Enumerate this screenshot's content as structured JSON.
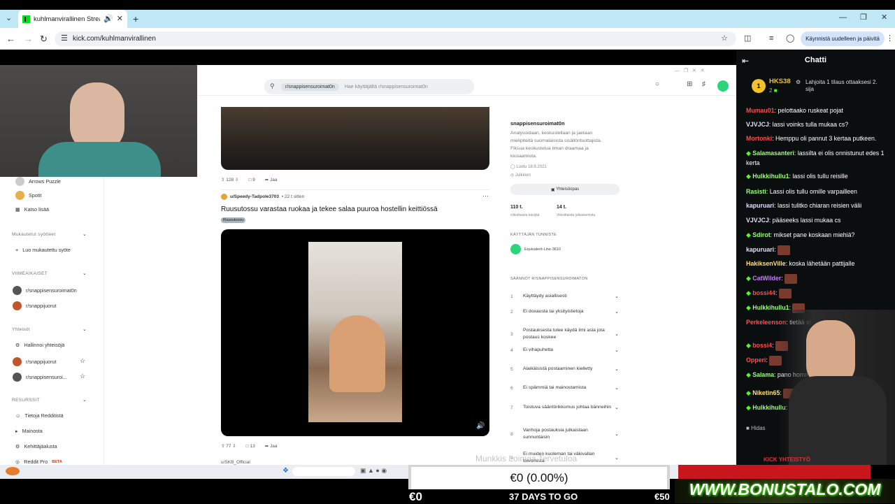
{
  "browser": {
    "tab_title": "kuhlmanvirallinen Stream -",
    "url": "kick.com/kuhlmanvirallinen",
    "update_button": "Käynnistä uudelleen ja päivitä"
  },
  "reddit": {
    "search_chip": "r/snappisensuroimat0n",
    "search_placeholder": "Hae käyttäjältä r/snappisensuroimat0n",
    "sidebar": {
      "items_top": [
        "Arrows Puzzle",
        "Spotit",
        "Katso lisää"
      ],
      "custom_heading": "Mukautetut syötteet",
      "custom_item": "Luo mukautettu syöte",
      "recent_heading": "VIIMEAIKAISET",
      "recent": [
        "r/snappisensuroimat0n",
        "r/snappijuorut"
      ],
      "communities_heading": "Yhteisöt",
      "communities": [
        "Hallinnoi yhteisöjä",
        "r/snappijuorut",
        "r/snappisensuroi..."
      ],
      "resources_heading": "RESURSSIT",
      "resources": [
        "Tietoja Redditistä",
        "Mainosta",
        "Kehittäjäalusta",
        "Reddit Pro"
      ],
      "beta": "BETA"
    },
    "post1": {
      "upvotes": "128",
      "comments": "9",
      "share": "Jaa"
    },
    "post2": {
      "author": "u/Speedy-Tadpole3703",
      "time": "• 22 t sitten",
      "title": "Ruusutossu varastaa ruokaa ja tekee salaa puuroa hostellin keittiössä",
      "flair": "Ruusutossu",
      "upvotes": "77",
      "comments": "13",
      "share": "Jaa"
    },
    "post3_author": "u/SKB_Official",
    "about": {
      "name": "snappisensuroimat0n",
      "desc": "Analysoidaan, keskustellaan ja jaetaan mielipiteitä suomalaisista sisällöntuottajista. Fiksua keskustelua ilman draamaa ja kiusaamista.",
      "created": "Luotu 18.9.2021",
      "visibility": "Julkinen",
      "guide_button": "Yhteisöopas",
      "visitors": "110 t.",
      "visitors_label": "viikoittaista kävijää",
      "contribs": "14 t.",
      "contribs_label": "Viikoittaista julkaisemista",
      "flair_heading": "KÄYTTÄJÄN TUNNISTE",
      "user": "Equivalent-Line-3610",
      "rules_heading": "SÄÄNNÖT R/SNAPPISENSUROIMATON",
      "rules": [
        {
          "n": "1",
          "t": "Käyttäydy asiallisesti"
        },
        {
          "n": "2",
          "t": "Ei doxausta tai yksityistietoja"
        },
        {
          "n": "3",
          "t": "Postauksesta tulee käydä ilmi asia jota postaus koskee"
        },
        {
          "n": "4",
          "t": "Ei vihapuhetta"
        },
        {
          "n": "5",
          "t": "Alaikäisistä postaaminen kielletty"
        },
        {
          "n": "6",
          "t": "Ei spämmiä tai mainostamista"
        },
        {
          "n": "7",
          "t": "Toistuva sääntörikkomus johtaa bänneihin"
        },
        {
          "n": "8",
          "t": "Vanhoja postauksia julkaistaan sunnuntaisin"
        },
        {
          "n": "9",
          "t": "Ei muiden kuoleman tai väkivallan toivomista"
        }
      ]
    },
    "watermark": "Munkkis Loimaa Tervetuloa"
  },
  "chat": {
    "title": "Chatti",
    "gifter_rank": "1",
    "gifter_name": "HKS38",
    "gifter_count": "2",
    "gift_text": "Lahjoita 1 tilaus ottaaksesi 2. sija",
    "messages": [
      {
        "user": "Mumau01",
        "color": "#ff4d4d",
        "text": "pelottaako ruskeat pojat",
        "badge": false
      },
      {
        "user": "VJVJCJ",
        "color": "#e0e0ff",
        "text": "lassi voinks tulla mukaa cs?",
        "badge": false
      },
      {
        "user": "Mortonki",
        "color": "#ff4d4d",
        "text": "Hemppu oli pannut 3 kertaa putkeen.",
        "badge": false
      },
      {
        "user": "Salamasanteri",
        "color": "#9cff7a",
        "text": "lassilta ei olis onnistunut edes 1 kerta",
        "badge": true
      },
      {
        "user": "Hulkkihullu1",
        "color": "#9cff7a",
        "text": "lassi olis tullu reisille",
        "badge": true
      },
      {
        "user": "Rasisti",
        "color": "#9cff7a",
        "text": "Lassi olis tullu omille varpailleen",
        "badge": false
      },
      {
        "user": "kapuruari",
        "color": "#e0e0ff",
        "text": "lassi tulitko chiaran reisien välii",
        "badge": false
      },
      {
        "user": "VJVJCJ",
        "color": "#e0e0ff",
        "text": "pääseeks lassi mukaa cs",
        "badge": false
      },
      {
        "user": "Sdirot",
        "color": "#9cff7a",
        "text": "mikset pane koskaan miehiä?",
        "badge": true
      },
      {
        "user": "kapuruari",
        "color": "#e0e0ff",
        "text": "",
        "badge": false
      },
      {
        "user": "HakiksenVille",
        "color": "#ffe07a",
        "text": "koska lähetään pattijalle",
        "badge": false
      },
      {
        "user": "CatWilder",
        "color": "#c77dff",
        "text": "",
        "badge": true
      },
      {
        "user": "bossi44",
        "color": "#ff4d4d",
        "text": "",
        "badge": true
      },
      {
        "user": "Hulkkihullu1",
        "color": "#9cff7a",
        "text": "",
        "badge": true
      },
      {
        "user": "Perkeleenson",
        "color": "#ff4d4d",
        "text": "tietää et chiaralla on",
        "badge": false
      },
      {
        "user": "bossi4",
        "color": "#ff4d4d",
        "text": "",
        "badge": true
      },
      {
        "user": "Opperi",
        "color": "#ff4d4d",
        "text": "",
        "badge": false
      },
      {
        "user": "Salama",
        "color": "#9cff7a",
        "text": "pano homma",
        "badge": true
      },
      {
        "user": "Niketin65",
        "color": "#ffe07a",
        "text": "",
        "badge": true
      },
      {
        "user": "Hulkkihullu",
        "color": "#9cff7a",
        "text": "",
        "badge": true
      }
    ],
    "slow": "Hidas"
  },
  "overlay": {
    "box": "€0 (0.00%)",
    "left": "€0",
    "center": "37 DAYS TO GO",
    "right": "€50",
    "banner": "WWW.BONUSTALO.COM",
    "kick": "KICK YHTEISTYÖ"
  },
  "colors": {
    "kick_green": "#53fc18",
    "chat_bg": "#0b0e0f",
    "tab_bar": "#bfe7f5"
  }
}
